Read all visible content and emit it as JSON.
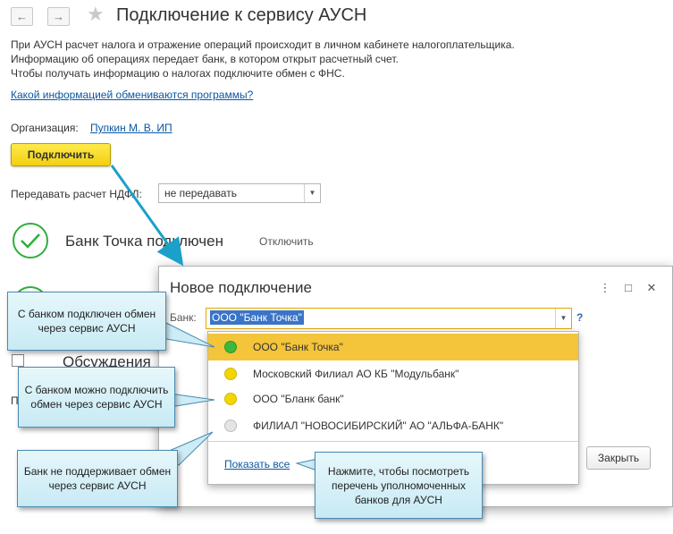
{
  "header": {
    "back_icon": "arrow-left",
    "forward_icon": "arrow-right",
    "favorite_icon": "star",
    "title": "Подключение к сервису АУСН"
  },
  "info": {
    "line1": "При АУСН расчет налога и отражение операций происходит в личном кабинете налогоплательщика.",
    "line2": "Информацию об операциях передает банк, в котором открыт расчетный счет.",
    "line3": "Чтобы получать информацию о налогах подключите обмен с ФНС.",
    "link": "Какой информацией обмениваются программы?"
  },
  "org": {
    "label": "Организация:",
    "value": "Пупкин М. В. ИП"
  },
  "connect_button": "Подключить",
  "ndfl": {
    "label": "Передавать расчет НДФЛ:",
    "value": "не передавать"
  },
  "bank_status": {
    "text": "Банк Точка подключен",
    "disconnect": "Отключить"
  },
  "background_partial": {
    "text": "Обсуждения",
    "letter": "П"
  },
  "dialog": {
    "title": "Новое подключение",
    "bank_label": "Банк:",
    "bank_value": "ООО \"Банк Точка\"",
    "help": "?",
    "close_button": "Закрыть",
    "show_all": "Показать все"
  },
  "dropdown_items": [
    {
      "label": "ООО \"Банк Точка\"",
      "status": "connected",
      "color": "#3cb83c"
    },
    {
      "label": "Московский Филиал АО КБ \"Модульбанк\"",
      "status": "available",
      "color": "#f2d600"
    },
    {
      "label": "ООО \"Бланк банк\"",
      "status": "available",
      "color": "#f2d600"
    },
    {
      "label": "ФИЛИАЛ \"НОВОСИБИРСКИЙ\" АО \"АЛЬФА-БАНК\"",
      "status": "unsupported",
      "color": "#d8d8d8"
    }
  ],
  "callouts": {
    "connected": "С банком подключен обмен через сервис АУСН",
    "available": "С банком можно подключить обмен через сервис АУСН",
    "unsupported": "Банк не поддерживает обмен через сервис АУСН",
    "show_all": "Нажмите, чтобы посмотреть перечень уполномоченных банков для АУСН"
  },
  "colors": {
    "accent_yellow": "#f3cf10",
    "link": "#0a57a4",
    "callout_bg": "#d6f0f8",
    "success": "#2fae3a"
  }
}
